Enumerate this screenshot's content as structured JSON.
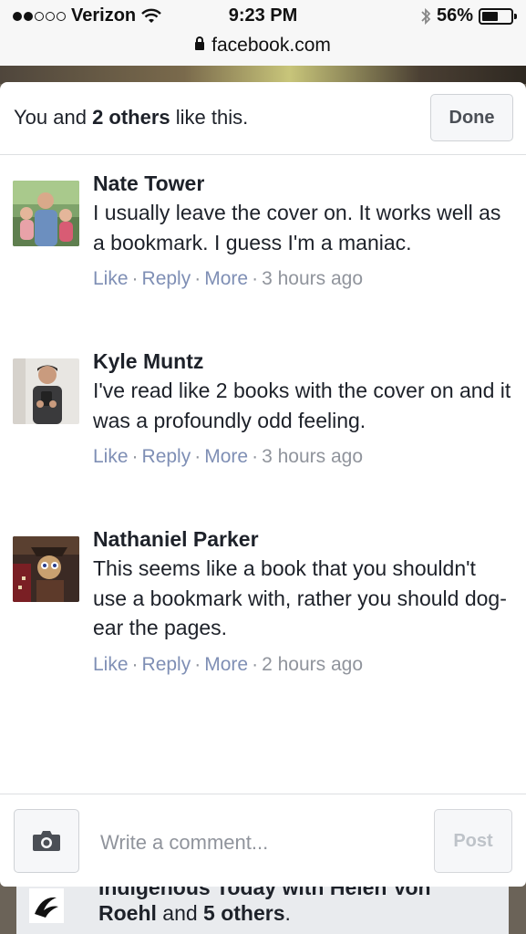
{
  "status_bar": {
    "carrier": "Verizon",
    "time": "9:23 PM",
    "battery": "56%",
    "battery_level": 0.56,
    "signal_bars": 2,
    "url": "facebook.com"
  },
  "likes_sheet": {
    "summary_prefix": "You and ",
    "summary_bold": "2 others",
    "summary_suffix": " like this.",
    "done_label": "Done"
  },
  "comments": [
    {
      "author": "Nate Tower",
      "text": "I usually leave the cover on. It works well as a bookmark. I guess I'm a maniac.",
      "actions": [
        "Like",
        "Reply",
        "More"
      ],
      "time": "3 hours ago"
    },
    {
      "author": "Kyle Muntz",
      "text": "I've read like 2 books with the cover on and it was a profoundly odd feeling.",
      "actions": [
        "Like",
        "Reply",
        "More"
      ],
      "time": "3 hours ago"
    },
    {
      "author": "Nathaniel Parker",
      "text": "This seems like a book that you shouldn't use a bookmark with, rather you should dog-ear the pages.",
      "actions": [
        "Like",
        "Reply",
        "More"
      ],
      "time": "2 hours ago"
    }
  ],
  "composer": {
    "placeholder": "Write a comment...",
    "post_label": "Post",
    "camera_icon": "camera-icon"
  },
  "background_post": {
    "line1": "Indigenous Today with Helen Von",
    "line2_name": "Roehl",
    "line2_mid": " and ",
    "line2_bold": "5 others",
    "line2_end": "."
  }
}
